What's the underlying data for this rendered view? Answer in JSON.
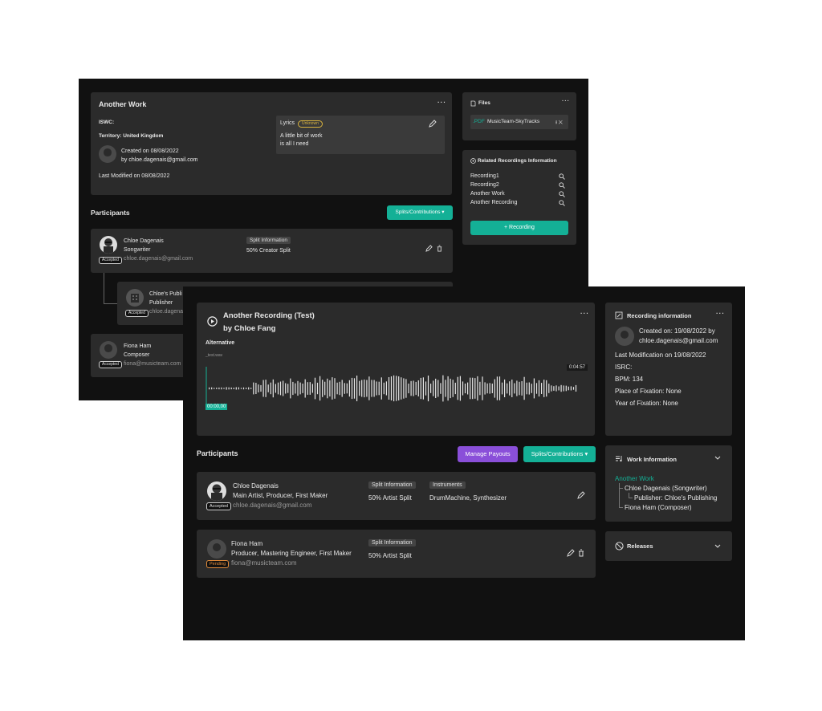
{
  "back": {
    "work": {
      "title": "Another Work",
      "more": "···",
      "iswc_label": "ISWC:",
      "territory": "Territory: United Kingdom",
      "created_on": "Created on 08/08/2022",
      "created_by": "by chloe.dagenais@gmail.com",
      "last_modified": "Last Modified on 08/08/2022",
      "lyrics_label": "Lyrics",
      "lyrics_badge": "Unknown",
      "lyrics_line1": "A little bit of work",
      "lyrics_line2": "is all I need"
    },
    "participants": {
      "title": "Participants",
      "splits_button": "Splits/Contributions ▾",
      "p1": {
        "name": "Chloe Dagenais",
        "role": "Songwriter",
        "email": "chloe.dagenais@gmail.com",
        "status": "Accepted",
        "split_label": "Split Information",
        "split_value": "50% Creator Split"
      },
      "p2": {
        "name": "Chloe's Publi",
        "role": "Publisher",
        "email": "chloe.dagena",
        "status": "Accepted"
      },
      "p3": {
        "name": "Fiona Ham",
        "role": "Composer",
        "email": "fiona@musicteam.com",
        "status": "Accepted"
      }
    },
    "files": {
      "title": "Files",
      "more": "···",
      "file_ext": ".PDF",
      "file_name": "MusicTeam-SkyTracks",
      "file_actions": "⭳ ✕"
    },
    "related": {
      "title": "Related Recordings Information",
      "items": [
        "Recording1",
        "Recording2",
        "Another Work",
        "Another Recording"
      ],
      "add_button": "+ Recording"
    }
  },
  "front": {
    "recording": {
      "title_line1": "Another Recording (Test)",
      "title_line2": "by Chloe Fang",
      "more": "···",
      "version": "Alternative",
      "filename": "_test.wav",
      "duration": "0:04:57",
      "current_time": "00:00,00",
      "progress": 0
    },
    "participants": {
      "title": "Participants",
      "manage_button": "Manage Payouts",
      "splits_button": "Splits/Contributions ▾",
      "p1": {
        "name": "Chloe Dagenais",
        "roles": "Main Artist, Producer, First Maker",
        "email": "chloe.dagenais@gmail.com",
        "status": "Accepted",
        "split_label": "Split Information",
        "split_value": "50% Artist Split",
        "instruments_label": "Instruments",
        "instruments_value": "DrumMachine, Synthesizer"
      },
      "p2": {
        "name": "Fiona Ham",
        "roles": "Producer, Mastering Engineer, First Maker",
        "email": "fiona@musicteam.com",
        "status": "Pending",
        "split_label": "Split Information",
        "split_value": "50% Artist Split"
      }
    },
    "rec_info": {
      "title": "Recording information",
      "more": "···",
      "created_on": "Created on: 19/08/2022 by",
      "created_by": "chloe.dagenais@gmail.com",
      "last_mod": "Last Modification on 19/08/2022",
      "isrc": "ISRC:",
      "bpm": "BPM: 134",
      "place": "Place of Fixation: None",
      "year": "Year of Fixation: None"
    },
    "work_info": {
      "title": "Work Information",
      "work_link": "Another Work",
      "child1": "Chloe Dagenais (Songwriter)",
      "child2": "Publisher: Chloe's Publishing",
      "child3": "Fiona Ham (Composer)"
    },
    "releases": {
      "title": "Releases"
    }
  },
  "colors": {
    "accent": "#14b096",
    "purple": "#8a4fd9",
    "background": "#111111",
    "card": "#2b2b2b",
    "pending": "#e08a3a",
    "unknown": "#d8b23e"
  }
}
